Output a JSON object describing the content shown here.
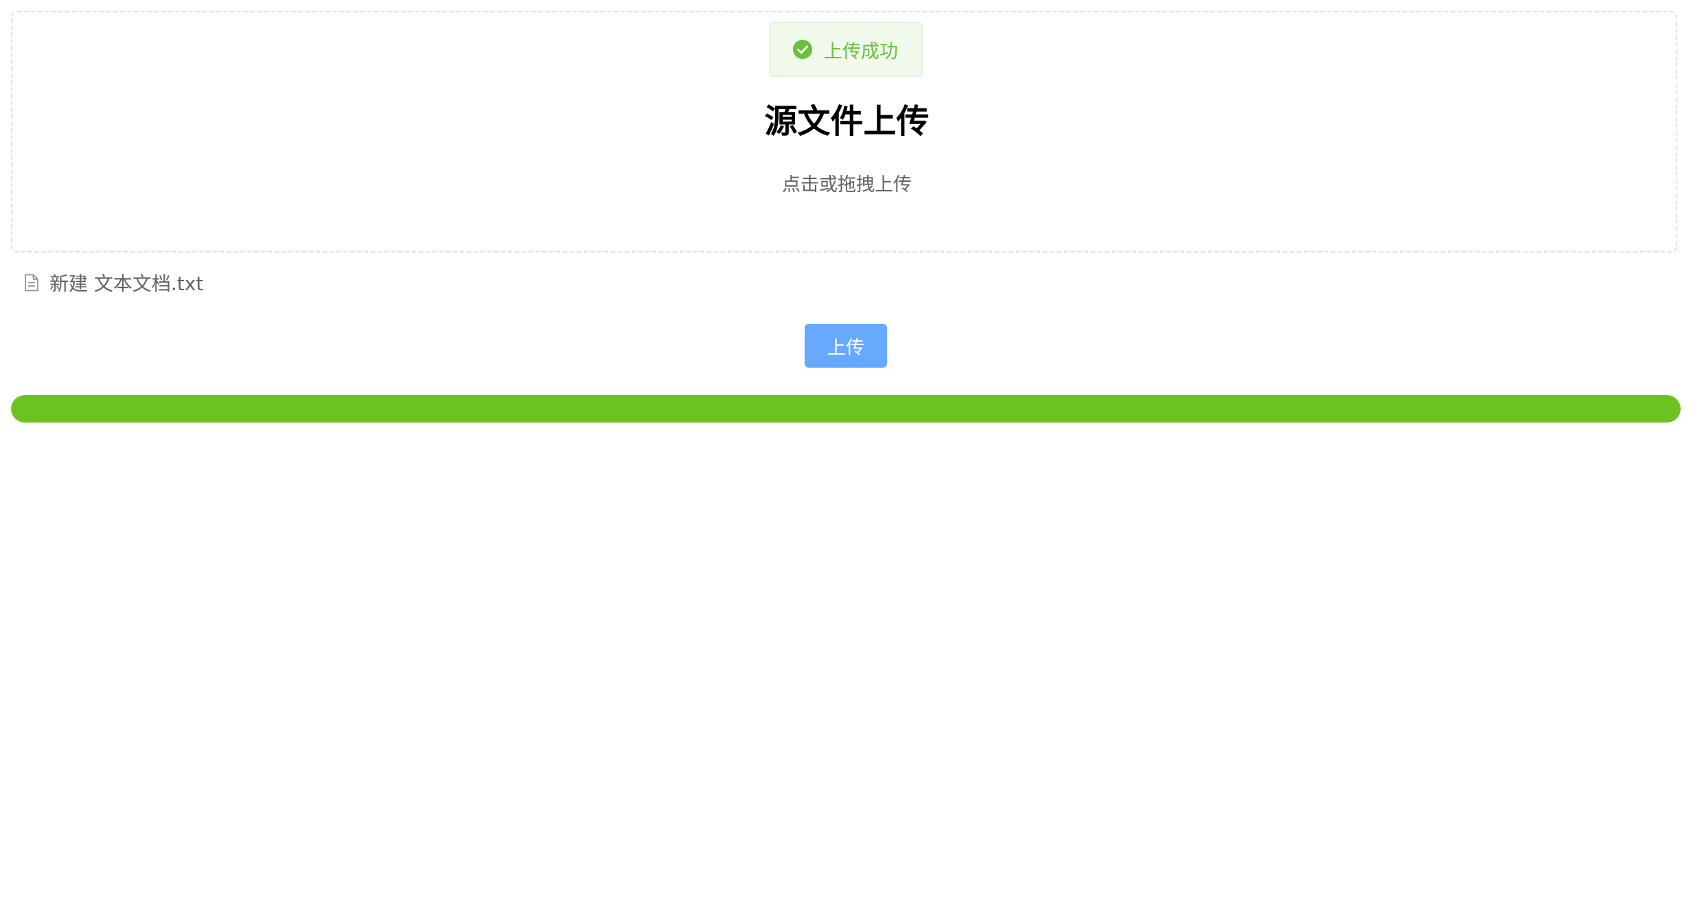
{
  "toast": {
    "message": "上传成功",
    "icon": "check-circle-icon",
    "color": "#67c23a"
  },
  "upload_area": {
    "title": "源文件上传",
    "hint": "点击或拖拽上传"
  },
  "file_list": [
    {
      "name": "新建 文本文档.txt",
      "icon": "document-icon"
    }
  ],
  "upload_button": {
    "label": "上传",
    "color": "#66a9ff"
  },
  "progress": {
    "percent": 100,
    "color": "#6cc31f"
  }
}
